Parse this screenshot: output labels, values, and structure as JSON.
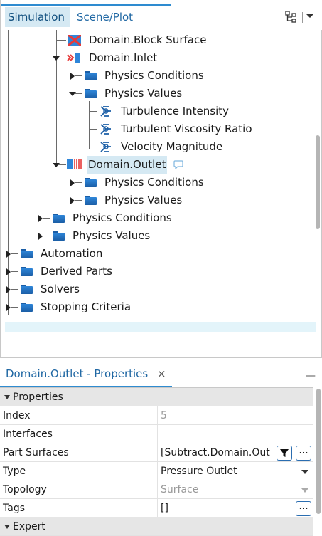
{
  "tabs": {
    "simulation": "Simulation",
    "scene_plot": "Scene/Plot"
  },
  "icons": {
    "hierarchy": "hierarchy-icon",
    "menu": "dropdown-menu-icon"
  },
  "tree": {
    "block_surface": "Domain.Block Surface",
    "inlet": "Domain.Inlet",
    "inlet_physics_conditions": "Physics Conditions",
    "inlet_physics_values": "Physics Values",
    "turbulence_intensity": "Turbulence Intensity",
    "turbulent_viscosity_ratio": "Turbulent Viscosity Ratio",
    "velocity_magnitude": "Velocity Magnitude",
    "outlet": "Domain.Outlet",
    "outlet_physics_conditions": "Physics Conditions",
    "outlet_physics_values": "Physics Values",
    "region_physics_conditions": "Physics Conditions",
    "region_physics_values": "Physics Values",
    "automation": "Automation",
    "derived_parts": "Derived Parts",
    "solvers": "Solvers",
    "stopping_criteria": "Stopping Criteria"
  },
  "properties_panel": {
    "title": "Domain.Outlet - Properties",
    "close": "×",
    "minimize": "—",
    "section_properties": "Properties",
    "section_expert": "Expert",
    "rows": {
      "index": {
        "name": "Index",
        "value": "5"
      },
      "interfaces": {
        "name": "Interfaces",
        "value": ""
      },
      "part_surfaces": {
        "name": "Part Surfaces",
        "value": "[Subtract.Domain.Out"
      },
      "type": {
        "name": "Type",
        "value": "Pressure Outlet"
      },
      "topology": {
        "name": "Topology",
        "value": "Surface"
      },
      "tags": {
        "name": "Tags",
        "value": "[]"
      }
    },
    "ellipsis": "..."
  },
  "colors": {
    "accent": "#2e8bd0",
    "selection": "#d5e9f3",
    "folder": "#2f86d9"
  }
}
